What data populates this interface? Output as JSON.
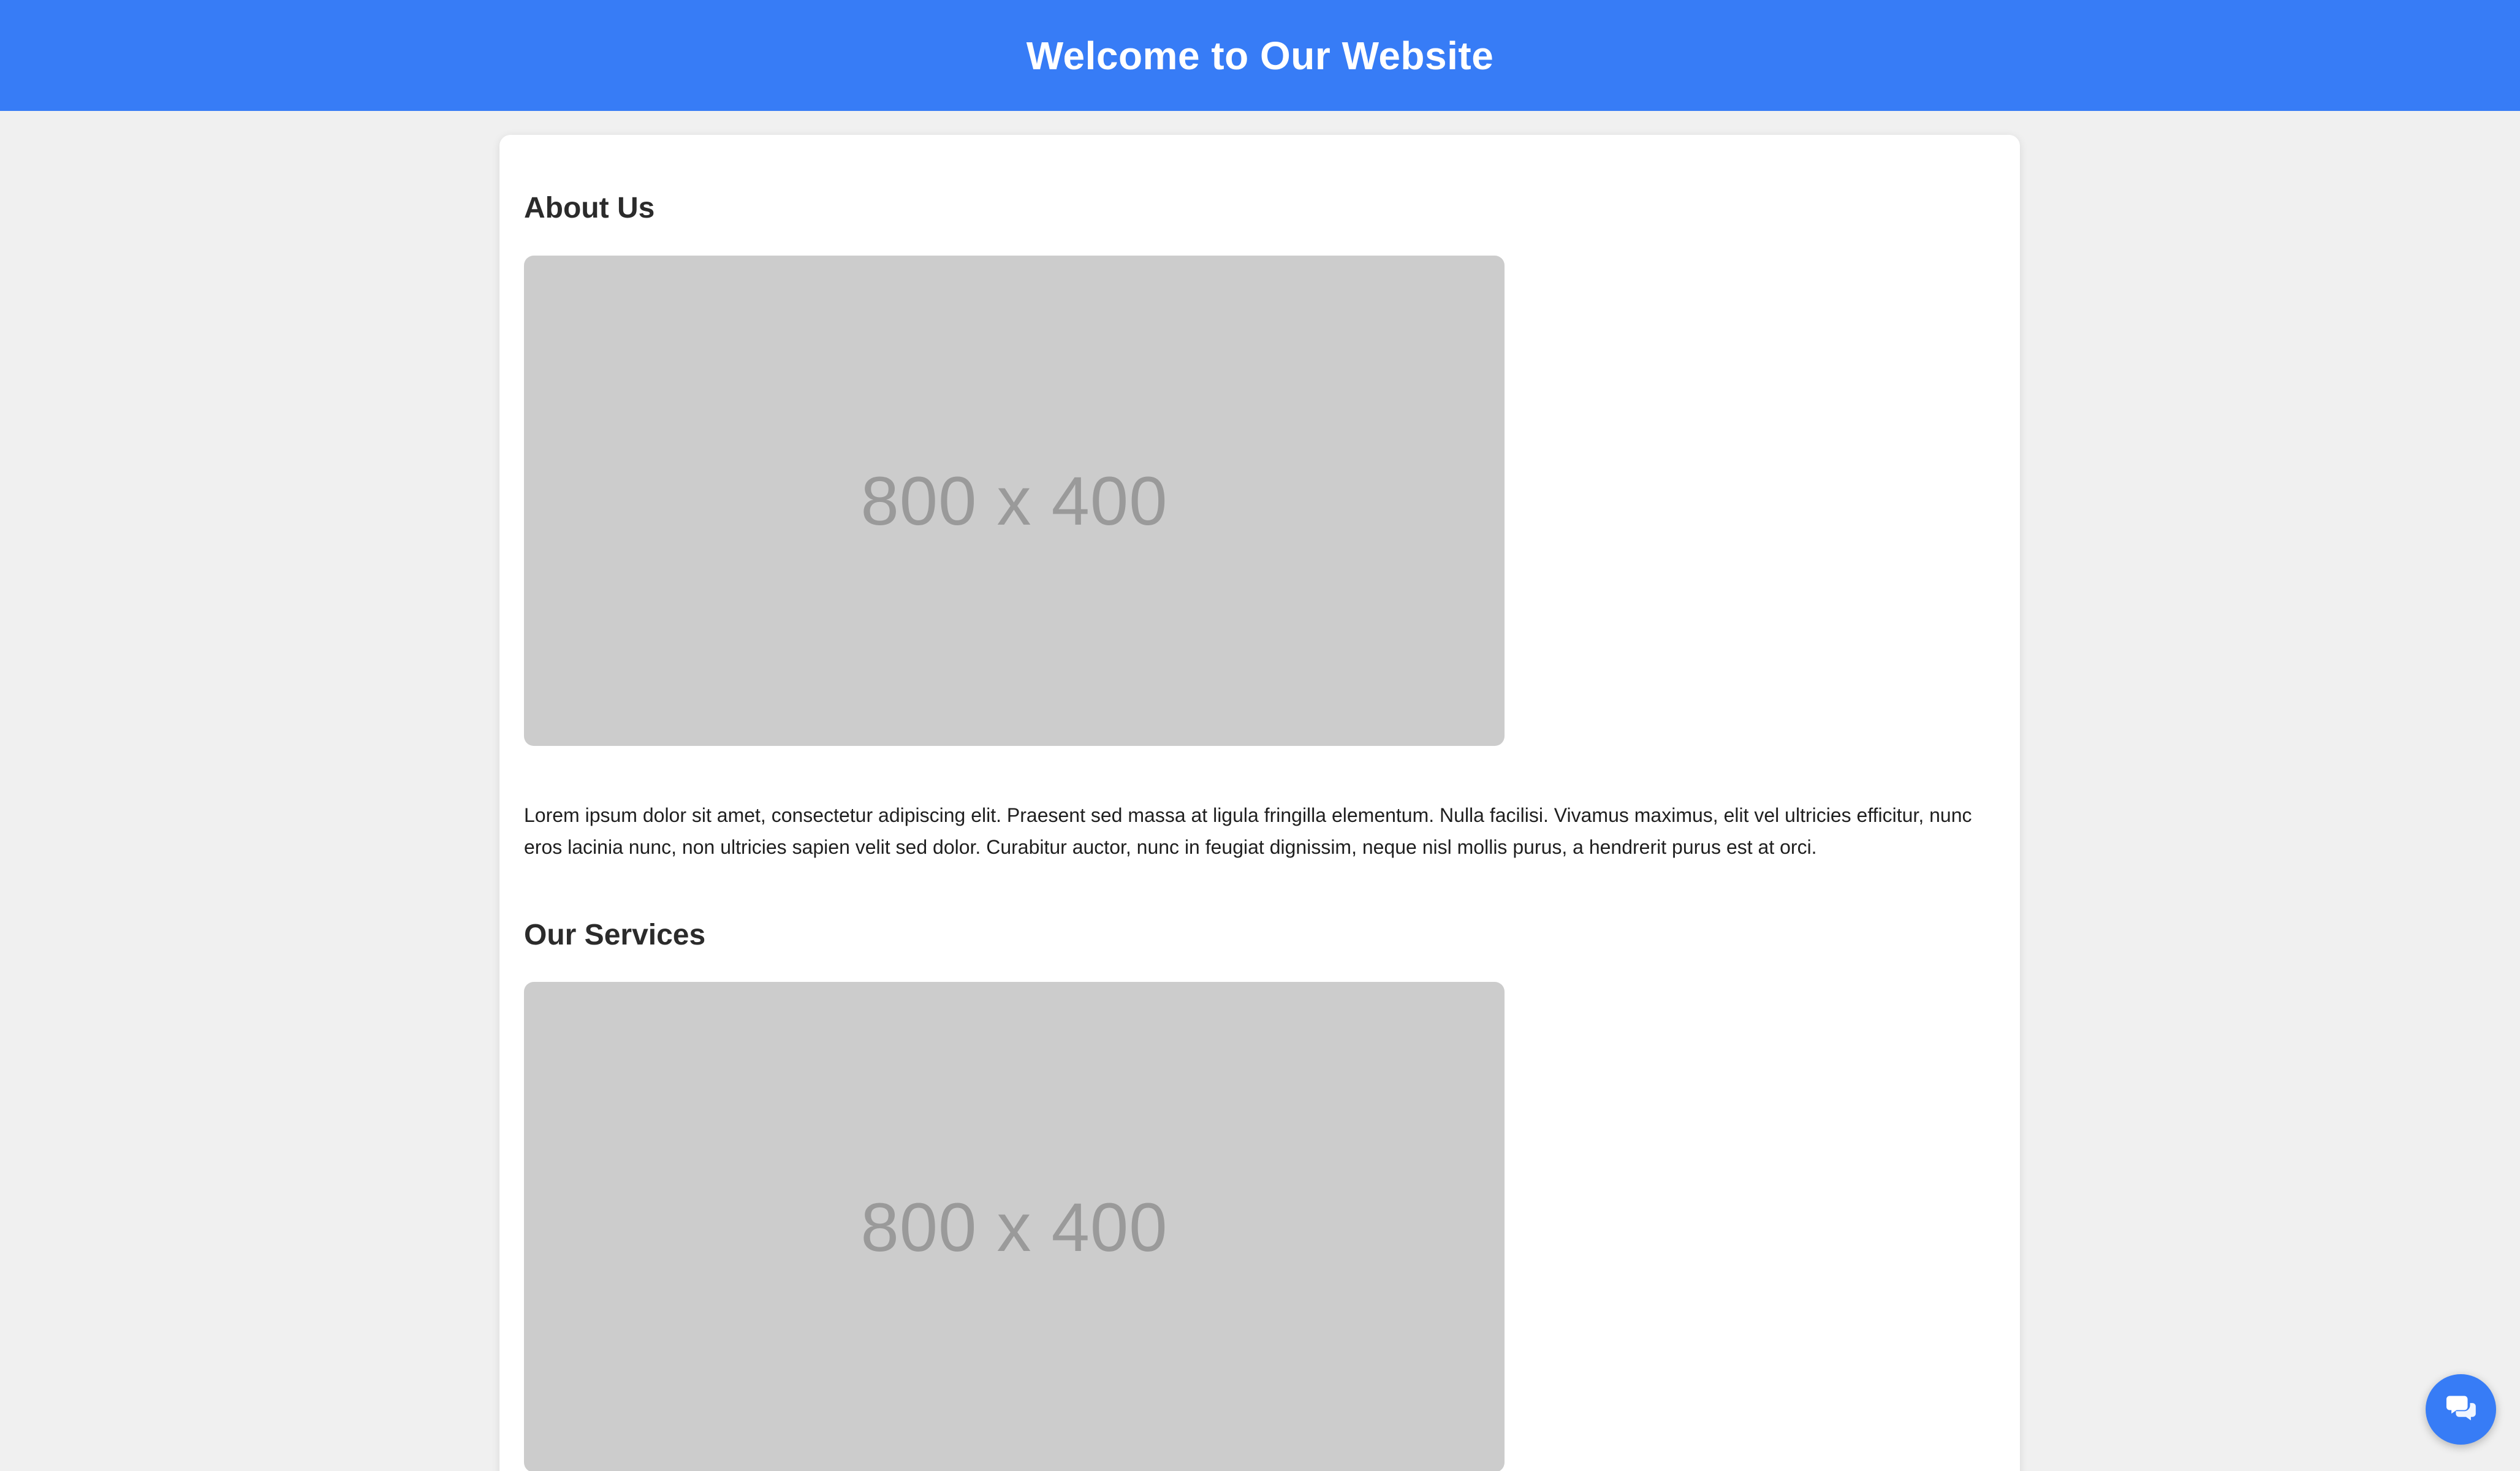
{
  "header": {
    "title": "Welcome to Our Website"
  },
  "sections": [
    {
      "heading": "About Us",
      "image_placeholder": "800 x 400",
      "text": "Lorem ipsum dolor sit amet, consectetur adipiscing elit. Praesent sed massa at ligula fringilla elementum. Nulla facilisi. Vivamus maximus, elit vel ultricies efficitur, nunc eros lacinia nunc, non ultricies sapien velit sed dolor. Curabitur auctor, nunc in feugiat dignissim, neque nisl mollis purus, a hendrerit purus est at orci."
    },
    {
      "heading": "Our Services",
      "image_placeholder": "800 x 400"
    }
  ],
  "chat": {
    "icon": "chat-bubbles-icon"
  },
  "colors": {
    "brand": "#377cf6",
    "page_background": "#f0f0f0",
    "placeholder": "#cccccc"
  }
}
